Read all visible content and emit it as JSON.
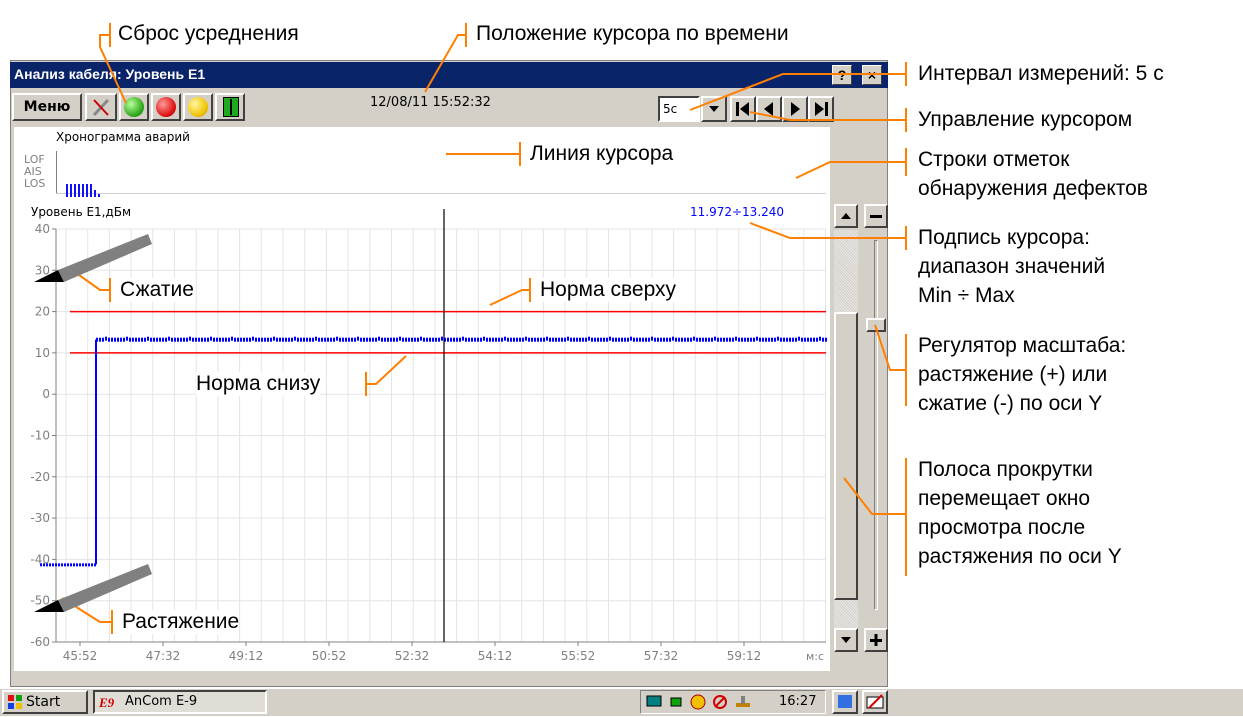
{
  "window": {
    "title": "Анализ кабеля: Уровень E1",
    "help_label": "?",
    "close_label": "×"
  },
  "toolbar": {
    "menu_label": "Меню",
    "datetime": "12/08/11 15:52:32",
    "interval_value": "5с"
  },
  "alarm_panel": {
    "title": "Хронограмма аварий",
    "rows": [
      "LOF",
      "AIS",
      "LOS"
    ]
  },
  "chart_panel": {
    "title": "Уровень E1,дБм",
    "cursor_readout": "11.972÷13.240"
  },
  "annotations": {
    "reset": "Сброс усреднения",
    "cursor_time": "Положение курсора по времени",
    "interval": "Интервал измерений: 5 с",
    "cursor_control": "Управление курсором",
    "cursor_line": "Линия курсора",
    "defect_rows": [
      "Строки отметок",
      "обнаружения дефектов"
    ],
    "cursor_label": [
      "Подпись курсора:",
      "диапазон значений",
      "Min ÷ Max"
    ],
    "compress": "Сжатие",
    "norm_top": "Норма сверху",
    "norm_bottom": "Норма снизу",
    "scale_regulator": [
      "Регулятор масштаба:",
      "растяжение (+) или",
      "сжатие (-) по оси Y"
    ],
    "scrollbar": [
      "Полоса прокрутки",
      "перемещает окно",
      "просмотра после",
      "растяжения по оси Y"
    ],
    "stretch": "Растяжение"
  },
  "taskbar": {
    "start_label": "Start",
    "app_label": "AnCom E-9",
    "app_icon_label": "E9",
    "clock": "16:27"
  },
  "chart_data": {
    "type": "line",
    "ylim": [
      -60,
      40
    ],
    "yticks": [
      "40",
      "30",
      "20",
      "10",
      "0",
      "-10",
      "-20",
      "-30",
      "-40",
      "-50",
      "-60"
    ],
    "xticks": [
      "45:52",
      "47:32",
      "49:12",
      "50:52",
      "52:32",
      "54:12",
      "55:52",
      "57:32",
      "59:12"
    ],
    "x_unit": "м:с",
    "norm_upper": 20,
    "norm_lower": 10,
    "series": [
      {
        "values_before_step": -41.2,
        "values_after_step": 13.2
      }
    ],
    "cursor_time": "52:32",
    "cursor_range": "11.972÷13.240"
  },
  "colors": {
    "title_bar": "#0a246a",
    "series": "#0000ff",
    "norm_lines": "#ff0000",
    "annotation_leader": "#ff8000"
  }
}
